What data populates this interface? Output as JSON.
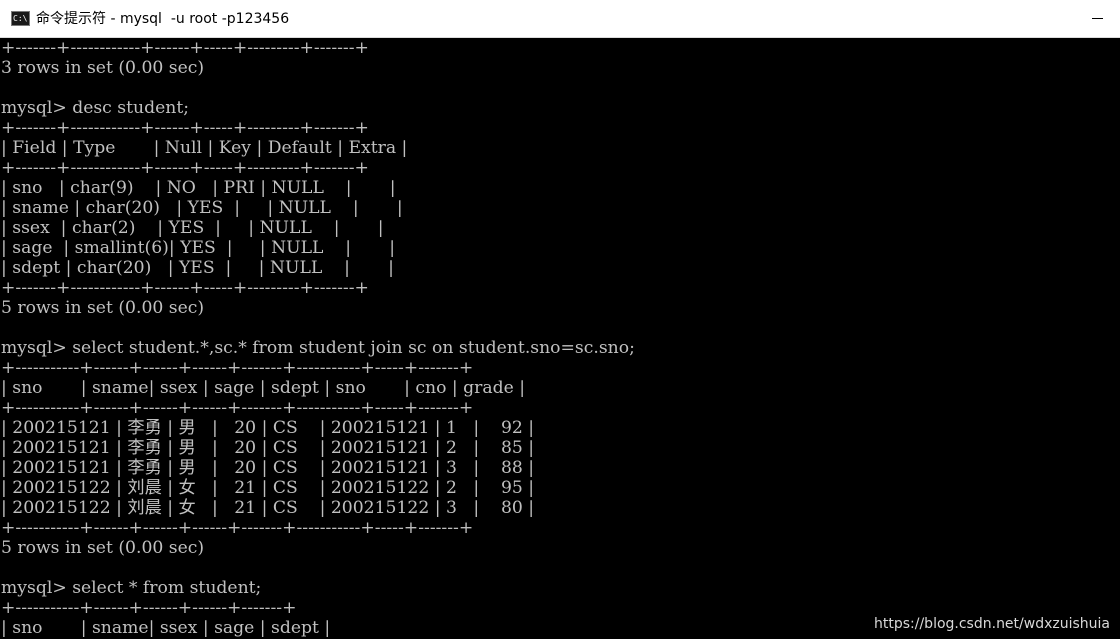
{
  "window": {
    "title": "命令提示符 - mysql  -u root -p123456",
    "icon_text": "C:\\.",
    "minimize_symbol": "—"
  },
  "console": {
    "lines": [
      "+-------+------------+------+-----+---------+-------+",
      "3 rows in set (0.00 sec)",
      "",
      "mysql> desc student;",
      "+-------+------------+------+-----+---------+-------+",
      "| Field | Type       | Null | Key | Default | Extra |",
      "+-------+------------+------+-----+---------+-------+",
      "| sno   | char(9)    | NO   | PRI | NULL    |       |",
      "| sname | char(20)   | YES  |     | NULL    |       |",
      "| ssex  | char(2)    | YES  |     | NULL    |       |",
      "| sage  | smallint(6)| YES  |     | NULL    |       |",
      "| sdept | char(20)   | YES  |     | NULL    |       |",
      "+-------+------------+------+-----+---------+-------+",
      "5 rows in set (0.00 sec)",
      "",
      "mysql> select student.*,sc.* from student join sc on student.sno=sc.sno;",
      "+-----------+------+------+------+-------+-----------+-----+-------+",
      "| sno       | sname| ssex | sage | sdept | sno       | cno | grade |",
      "+-----------+------+------+------+-------+-----------+-----+-------+",
      "| 200215121 | 李勇 | 男   |   20 | CS    | 200215121 | 1   |    92 |",
      "| 200215121 | 李勇 | 男   |   20 | CS    | 200215121 | 2   |    85 |",
      "| 200215121 | 李勇 | 男   |   20 | CS    | 200215121 | 3   |    88 |",
      "| 200215122 | 刘晨 | 女   |   21 | CS    | 200215122 | 2   |    95 |",
      "| 200215122 | 刘晨 | 女   |   21 | CS    | 200215122 | 3   |    80 |",
      "+-----------+------+------+------+-------+-----------+-----+-------+",
      "5 rows in set (0.00 sec)",
      "",
      "mysql> select * from student;",
      "+-----------+------+------+------+-------+",
      "| sno       | sname| ssex | sage | sdept |"
    ]
  },
  "watermark": "https://blog.csdn.net/wdxzuishuia"
}
